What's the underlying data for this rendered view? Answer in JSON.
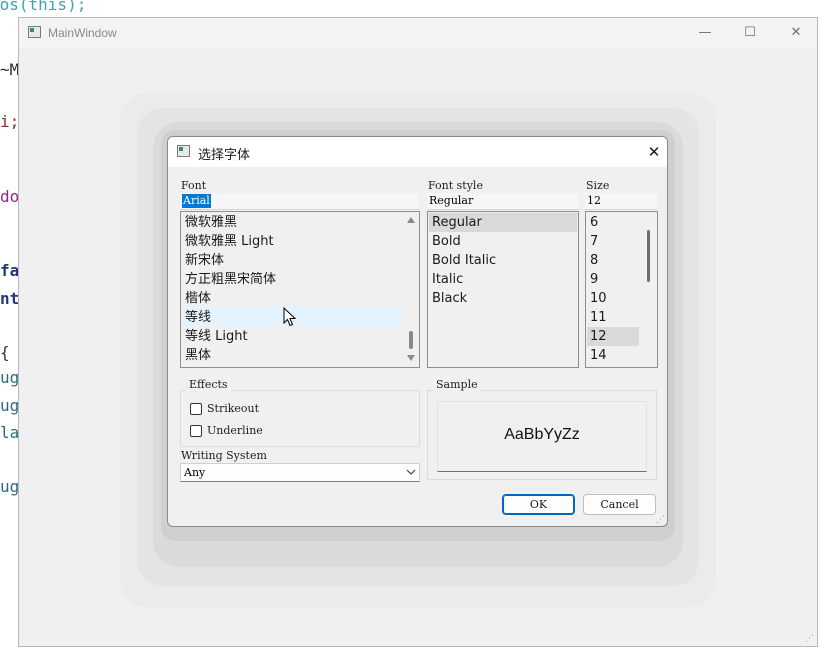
{
  "background_code": [
    {
      "text": "pos(this);",
      "color": "#3ca3b0"
    },
    {
      "text": "~M",
      "color": "#2a2a2a"
    },
    {
      "text": "i;",
      "color": "#8b2b2b"
    },
    {
      "text": "do",
      "color": "#8a2a8a"
    },
    {
      "text": "fa",
      "color": "#1d3a78"
    },
    {
      "text": "nt",
      "color": "#1d3a78"
    },
    {
      "text": "{",
      "color": "#333333"
    },
    {
      "text": "ug",
      "color": "#2a6a7a"
    },
    {
      "text": "ug",
      "color": "#2a6a7a"
    },
    {
      "text": "la",
      "color": "#2a6a7a"
    },
    {
      "text": "ug",
      "color": "#2a6a7a"
    }
  ],
  "main_window": {
    "title": "MainWindow",
    "controls": {
      "minimize": "—",
      "maximize": "☐",
      "close": "✕"
    }
  },
  "dialog": {
    "title": "选择字体",
    "close_glyph": "✕",
    "font": {
      "label": "Font",
      "value": "Arial",
      "items": [
        "微软雅黑",
        "微软雅黑 Light",
        "新宋体",
        "方正粗黑宋简体",
        "楷体",
        "等线",
        "等线 Light",
        "黑体"
      ],
      "hovered_index": 5
    },
    "font_style": {
      "label": "Font style",
      "value": "Regular",
      "items": [
        "Regular",
        "Bold",
        "Bold Italic",
        "Italic",
        "Black"
      ],
      "selected_index": 0
    },
    "size": {
      "label": "Size",
      "value": "12",
      "items": [
        "6",
        "7",
        "8",
        "9",
        "10",
        "11",
        "12",
        "14"
      ],
      "selected_index": 6
    },
    "effects": {
      "title": "Effects",
      "strikeout_label": "Strikeout",
      "underline_label": "Underline",
      "strikeout_checked": false,
      "underline_checked": false
    },
    "sample": {
      "title": "Sample",
      "text": "AaBbYyZz"
    },
    "writing_system": {
      "label": "Writing System",
      "value": "Any"
    },
    "ok_label": "OK",
    "cancel_label": "Cancel"
  },
  "colors": {
    "selection_bg": "#0078d4",
    "hover_bg": "#e5f3ff",
    "selected_bg": "#d9d9d9",
    "ok_border": "#0067c0"
  }
}
